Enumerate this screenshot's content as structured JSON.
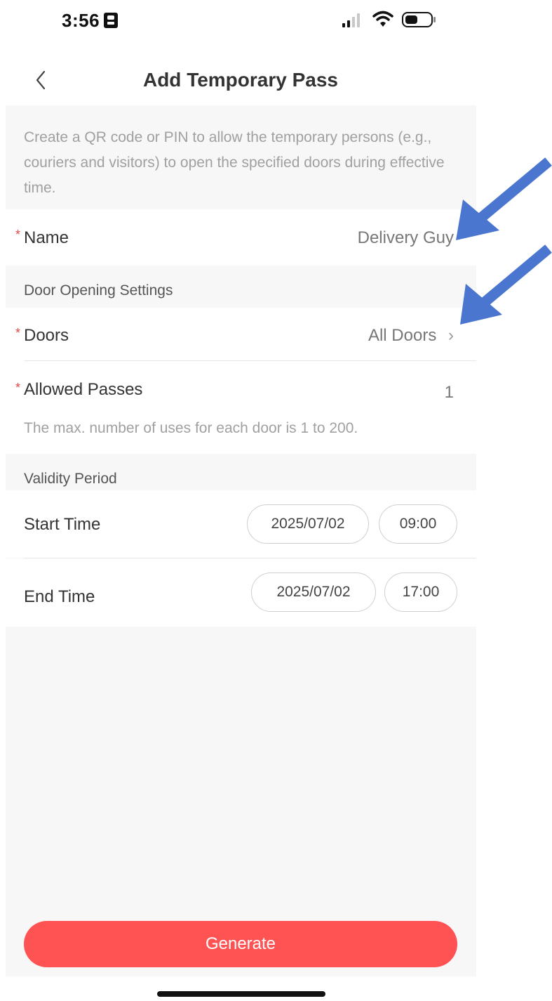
{
  "status_bar": {
    "time": "3:56",
    "icons": [
      "id-badge-icon",
      "cellular-signal-icon",
      "wifi-icon",
      "battery-icon"
    ]
  },
  "header": {
    "title": "Add Temporary Pass",
    "back_icon": "chevron-left-icon"
  },
  "intro": {
    "text": "Create a QR code or PIN to allow the temporary persons (e.g., couriers and visitors) to open the specified doors during effective time."
  },
  "form": {
    "name": {
      "required_mark": "*",
      "label": "Name",
      "value": "Delivery Guy"
    },
    "door_section_title": "Door Opening Settings",
    "doors": {
      "required_mark": "*",
      "label": "Doors",
      "value": "All Doors",
      "chevron": "›"
    },
    "allowed_passes": {
      "required_mark": "*",
      "label": "Allowed Passes",
      "value": "1",
      "hint": "The max. number of uses for each door is 1 to 200."
    },
    "validity_section_title": "Validity Period",
    "start_time": {
      "label": "Start Time",
      "date": "2025/07/02",
      "time": "09:00"
    },
    "end_time": {
      "label": "End Time",
      "date": "2025/07/02",
      "time": "17:00"
    }
  },
  "footer": {
    "generate_label": "Generate"
  },
  "annotations": {
    "arrow_color": "#4a76cf",
    "count": 2
  },
  "colors": {
    "accent": "#ff5252",
    "required": "#e04848"
  }
}
